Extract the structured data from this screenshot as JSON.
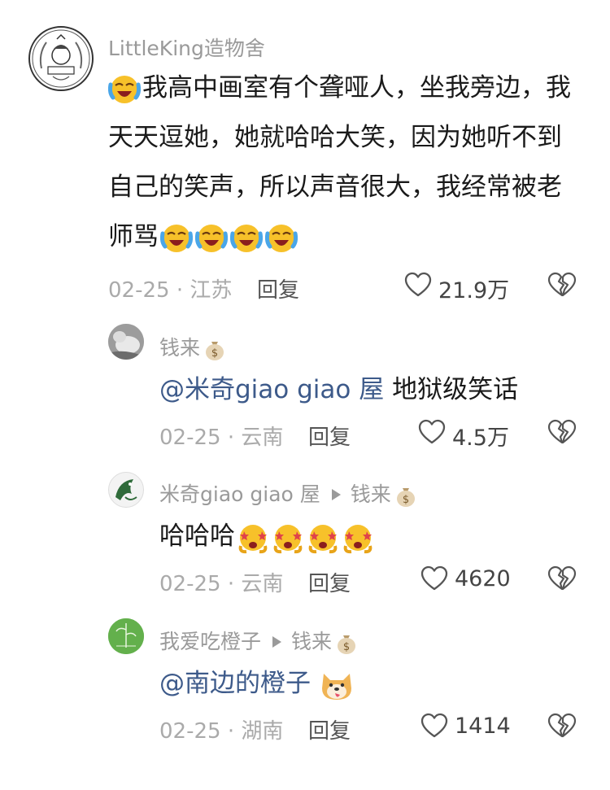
{
  "comments": [
    {
      "username": "LittleKing造物舍",
      "text_lines": [
        "我高中画室有个聋哑人，坐我旁边，我",
        "天天逗她，她就哈哈大笑，因为她听不到",
        "自己的笑声，所以声音很大，我经常被老",
        "师骂"
      ],
      "date": "02-25",
      "location": "江苏",
      "reply_label": "回复",
      "likes": "21.9万",
      "emojis": [
        "laugh-cry-emoji",
        "laugh-cry-emoji",
        "laugh-cry-emoji",
        "laugh-cry-emoji",
        "laugh-cry-emoji"
      ]
    }
  ],
  "replies": [
    {
      "username": "钱来",
      "mention": "@米奇giao giao 屋",
      "text": " 地狱级笑话",
      "date": "02-25",
      "location": "云南",
      "reply_label": "回复",
      "likes": "4.5万"
    },
    {
      "username": "米奇giao giao 屋",
      "reply_to": "钱来",
      "text": "哈哈哈",
      "date": "02-25",
      "location": "云南",
      "reply_label": "回复",
      "likes": "4620"
    },
    {
      "username": "我爱吃橙子",
      "reply_to": "钱来",
      "mention": "@南边的橙子",
      "date": "02-25",
      "location": "湖南",
      "reply_label": "回复",
      "likes": "1414"
    }
  ],
  "dot_separator": "·",
  "icons": {
    "like": "heart-outline-icon",
    "dislike": "broken-heart-icon",
    "money_bag": "money-bag-icon"
  },
  "colors": {
    "mention": "#3d5a8a",
    "meta": "#aaaaaa",
    "username": "#9a9a9a"
  }
}
